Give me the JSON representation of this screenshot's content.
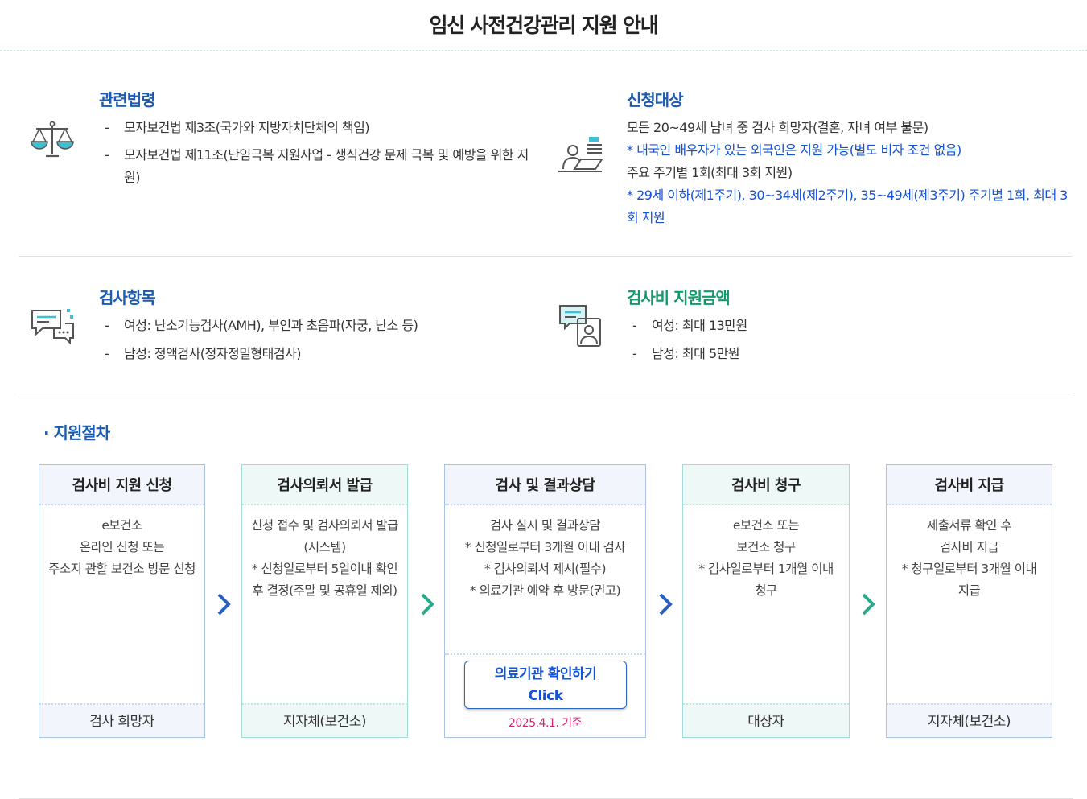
{
  "page": {
    "title": "임신 사전건강관리 지원 안내"
  },
  "law": {
    "title": "관련법령",
    "icon": "scales-icon",
    "items": [
      "모자보건법 제3조(국가와 지방자치단체의 책임)",
      "모자보건법 제11조(난임극복 지원사업 - 생식건강 문제 극복 및 예방을 위한 지원)"
    ]
  },
  "target": {
    "title": "신청대상",
    "icon": "applicant-laptop-icon",
    "line1": "모든 20~49세 남녀 중 검사 희망자(결혼, 자녀 여부 불문)",
    "note1": "* 내국인 배우자가 있는 외국인은 지원 가능(별도 비자 조건 없음)",
    "line2": "주요 주기별 1회(최대 3회 지원)",
    "note2": "* 29세 이하(제1주기), 30~34세(제2주기), 35~49세(제3주기) 주기별 1회, 최대 3회 지원"
  },
  "tests": {
    "title": "검사항목",
    "icon": "chat-bubbles-icon",
    "items": [
      "여성: 난소기능검사(AMH), 부인과 초음파(자궁, 난소 등)",
      "남성: 정액검사(정자정밀형태검사)"
    ]
  },
  "amount": {
    "title": "검사비 지원금액",
    "icon": "consultation-icon",
    "items": [
      "여성: 최대 13만원",
      "남성: 최대 5만원"
    ]
  },
  "procedure": {
    "title": "· 지원절차",
    "steps": [
      {
        "title": "검사비 지원 신청",
        "lines": [
          "e보건소",
          "온라인 신청 또는",
          "주소지 관할 보건소 방문 신청"
        ],
        "footer": "검사 희망자"
      },
      {
        "title": "검사의뢰서 발급",
        "lines": [
          "신청 접수 및 검사의뢰서 발급",
          "(시스템)",
          "* 신청일로부터 5일이내 확인",
          "후 결정(주말 및 공휴일 제외)"
        ],
        "footer": "지자체(보건소)"
      },
      {
        "title": "검사 및 결과상담",
        "lines": [
          "검사 실시 및 결과상담",
          "* 신청일로부터 3개월 이내 검사",
          "* 검사의뢰서 제시(필수)",
          "* 의료기관 예약 후 방문(권고)"
        ],
        "button_line1": "의료기관 확인하기",
        "button_line2": "Click",
        "date_note": "2025.4.1. 기준"
      },
      {
        "title": "검사비 청구",
        "lines": [
          "e보건소 또는",
          "보건소 청구",
          "* 검사일로부터 1개월 이내",
          "청구"
        ],
        "footer": "대상자"
      },
      {
        "title": "검사비 지급",
        "lines": [
          "제출서류 확인 후",
          "검사비 지급",
          "* 청구일로부터 3개월 이내",
          "지급"
        ],
        "footer": "지자체(보건소)"
      }
    ]
  },
  "colors": {
    "blue_title": "#1b5bb0",
    "teal_title": "#1a8f84",
    "green_title": "#149a6a",
    "note_blue": "#1452d6",
    "date_pink": "#d6246e",
    "arrow_blue": "#2a5fbf",
    "arrow_green": "#2aa88a"
  }
}
